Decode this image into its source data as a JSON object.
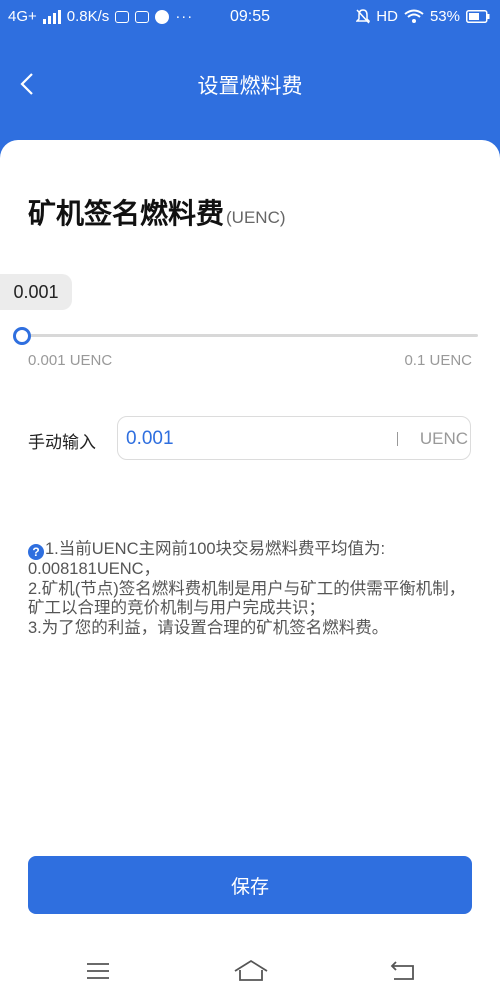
{
  "status_bar": {
    "network": "4G+",
    "speed": "0.8K/s",
    "dots": "···",
    "time": "09:55",
    "hd": "HD",
    "battery": "53%"
  },
  "header": {
    "title": "设置燃料费"
  },
  "fee": {
    "title": "矿机签名燃料费",
    "unit": "(UENC)",
    "slider_value": "0.001",
    "min_label": "0.001 UENC",
    "max_label": "0.1 UENC",
    "slider_level": 0.0
  },
  "manual": {
    "label": "手动输入",
    "value": "0.001",
    "unit": "UENC"
  },
  "notes": {
    "help_icon": "?",
    "line1": "1.当前UENC主网前100块交易燃料费平均值为:",
    "line2": "0.008181UENC，",
    "line3": "2.矿机(节点)签名燃料费机制是用户与矿工的供需平衡机制，矿工以合理的竞价机制与用户完成共识；",
    "line4": "3.为了您的利益，请设置合理的矿机签名燃料费。"
  },
  "save_button": {
    "label": "保存"
  },
  "colors": {
    "primary": "#2f6fdf",
    "track": "#d8d8d8",
    "tooltip_bg": "#ececec"
  },
  "icons": [
    "signal-icon",
    "mail-icon",
    "app-icon",
    "globe-icon",
    "mute-icon",
    "wifi-icon",
    "battery-icon",
    "back-arrow-icon",
    "menu-icon",
    "home-icon",
    "return-icon"
  ]
}
